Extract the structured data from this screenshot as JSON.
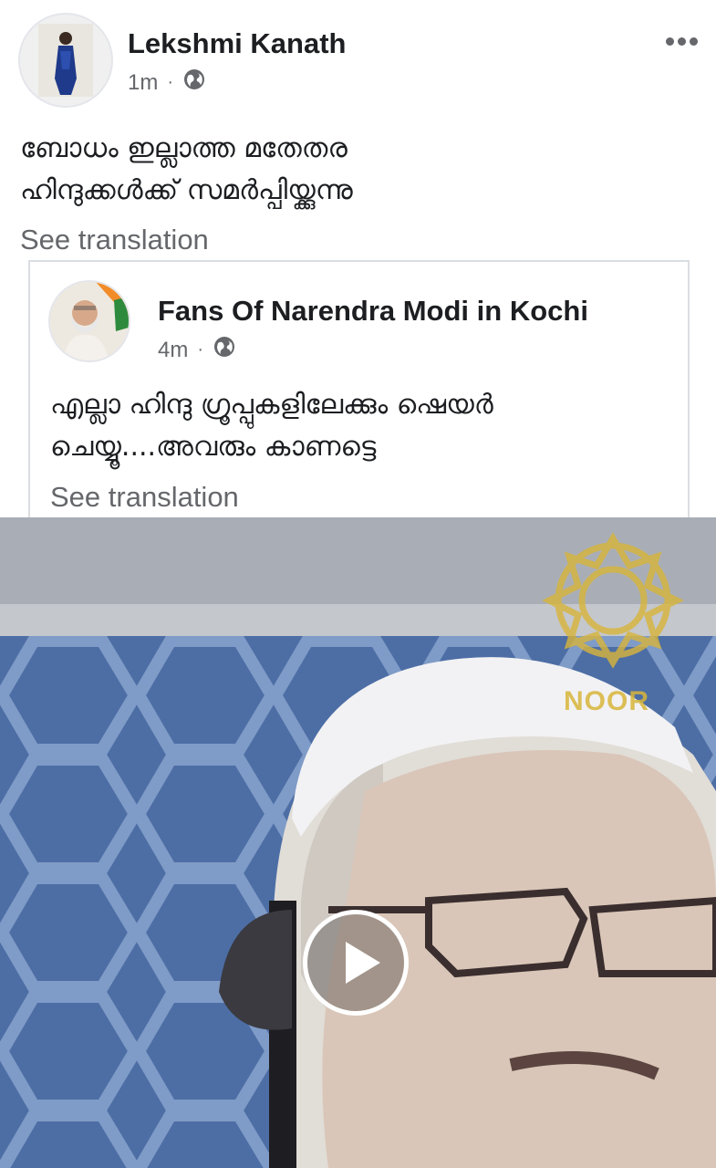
{
  "post": {
    "author": "Lekshmi Kanath",
    "time": "1m",
    "separator": "·",
    "privacy_icon": "globe-icon",
    "more_icon": "more-horizontal-icon",
    "text_line1": "ബോധം ഇല്ലാത്ത മതേതര",
    "text_line2": "ഹിന്ദുക്കൾക്ക് സമർപ്പിയ്ക്കുന്നു",
    "see_translation": "See translation"
  },
  "shared_post": {
    "author": "Fans Of Narendra Modi in Kochi",
    "time": "4m",
    "separator": "·",
    "privacy_icon": "globe-icon",
    "text_line1": "എല്ലാ  ഹിന്ദു ഗ്രൂപ്പുകളിലേക്കും ഷെയർ",
    "text_line2": "ചെയ്യൂ....അവരും കാണട്ടെ",
    "see_translation": "See translation"
  },
  "video": {
    "watermark_text": "NOOR",
    "play_icon": "play-icon",
    "colors": {
      "background": "#4d6ea5",
      "watermark": "#d8b53a"
    }
  }
}
